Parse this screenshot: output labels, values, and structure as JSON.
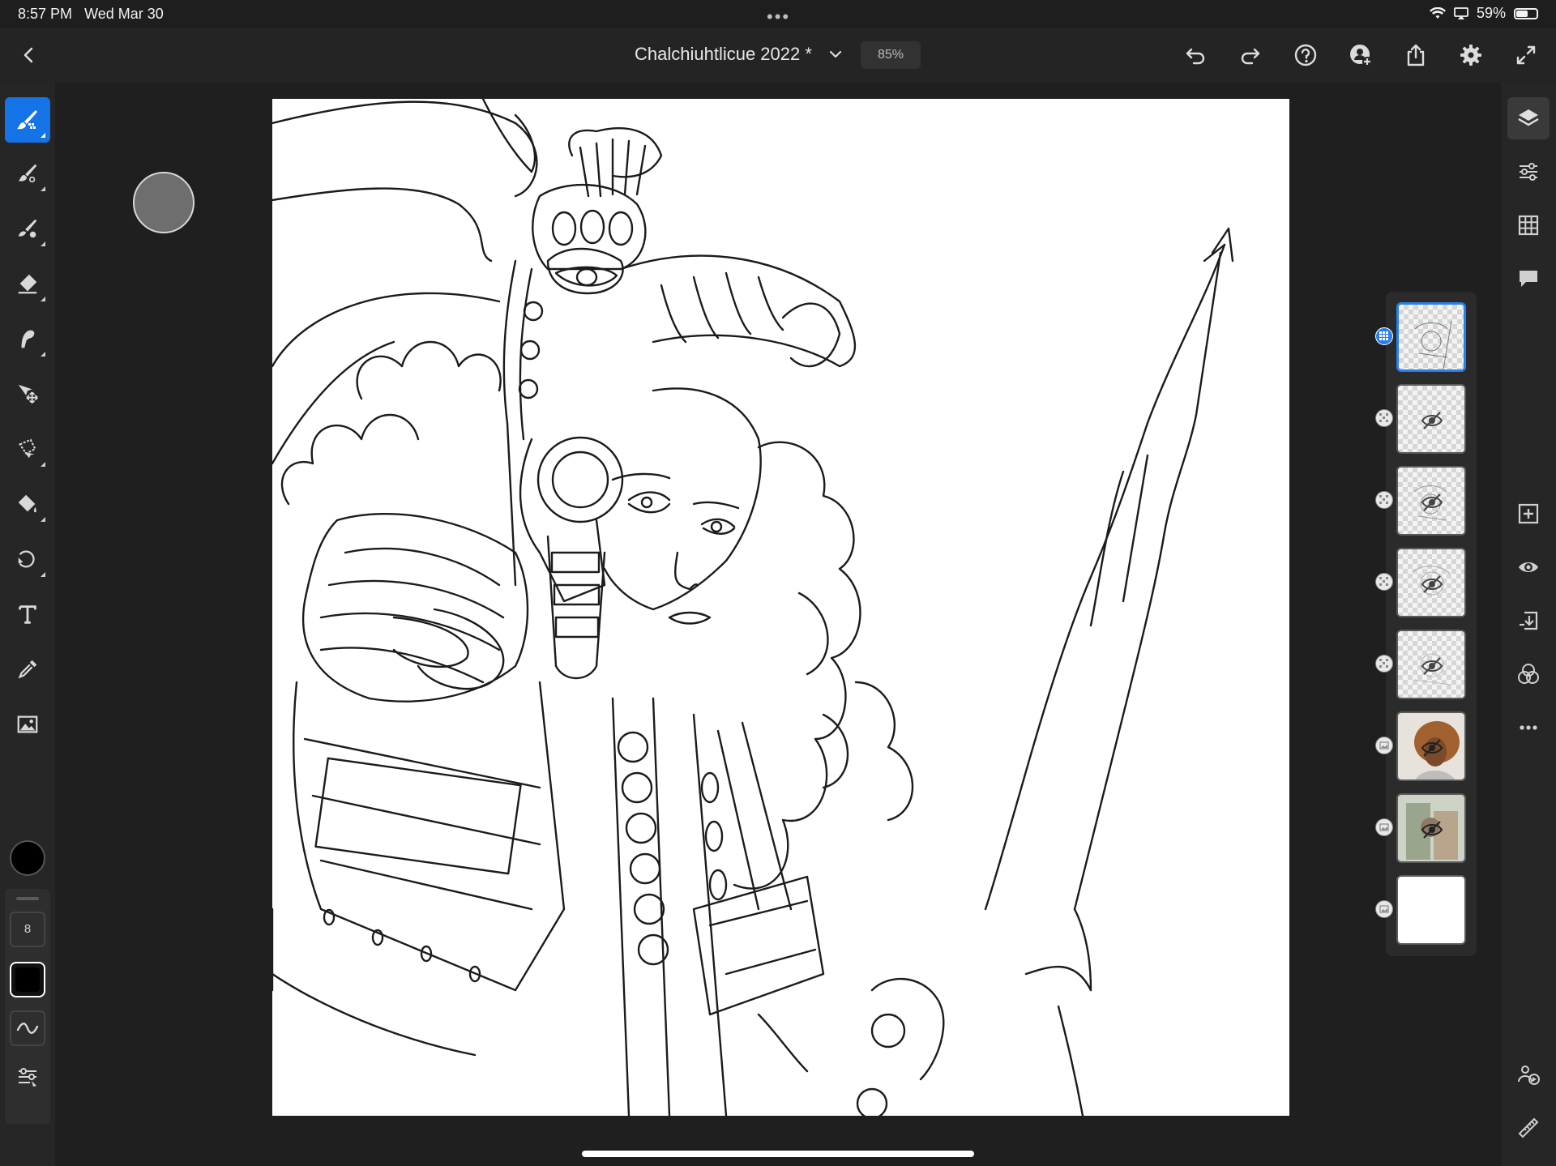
{
  "status_bar": {
    "time": "8:57 PM",
    "date": "Wed Mar 30",
    "battery": "59%",
    "battery_level": 0.59
  },
  "header": {
    "document_title": "Chalchiuhtlicue 2022 *",
    "zoom": "85%",
    "icons": [
      "back-icon",
      "chevron-down-icon",
      "undo-icon",
      "redo-icon",
      "help-icon",
      "invite-icon",
      "share-icon",
      "gear-icon",
      "fullscreen-icon"
    ]
  },
  "left_toolbar": {
    "tools": [
      "pixel-brush-tool",
      "live-brush-tool",
      "mixer-brush-tool",
      "eraser-tool",
      "smudge-tool",
      "move-tool",
      "lasso-tool",
      "fill-tool",
      "shape-tool",
      "text-tool",
      "eyedropper-tool",
      "place-image-tool"
    ],
    "active_tool": "pixel-brush-tool",
    "color": "#000000",
    "brush_size": "8"
  },
  "layers": {
    "count": 8,
    "active_index": 0,
    "items": [
      {
        "name": "layer-1",
        "visible": true,
        "type": "pixel"
      },
      {
        "name": "layer-2",
        "visible": false,
        "type": "pixel"
      },
      {
        "name": "layer-3",
        "visible": false,
        "type": "pixel"
      },
      {
        "name": "layer-4",
        "visible": false,
        "type": "pixel"
      },
      {
        "name": "layer-5",
        "visible": false,
        "type": "pixel"
      },
      {
        "name": "layer-6",
        "visible": false,
        "type": "image"
      },
      {
        "name": "layer-7",
        "visible": false,
        "type": "image"
      },
      {
        "name": "layer-8",
        "visible": true,
        "type": "image"
      }
    ]
  },
  "right_toolbar": {
    "icons": [
      "layers-icon",
      "adjustments-icon",
      "grid-icon",
      "comment-icon",
      "add-layer-icon",
      "visibility-icon",
      "merge-down-icon",
      "blend-modes-icon",
      "more-icon",
      "share-livestream-icon",
      "ruler-icon"
    ]
  },
  "colors": {
    "accent": "#1473e6",
    "background": "#1f1f1f",
    "canvas": "#ffffff"
  }
}
